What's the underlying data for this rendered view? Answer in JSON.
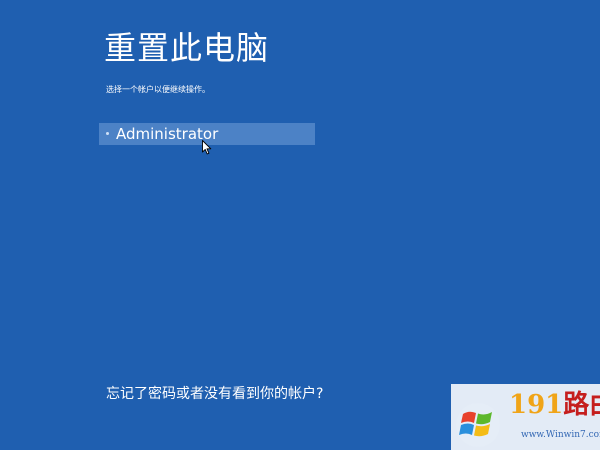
{
  "header": {
    "title": "重置此电脑",
    "subtitle": "选择一个帐户以便继续操作。"
  },
  "accounts": [
    {
      "name": "Administrator"
    }
  ],
  "footer": {
    "forgot_link": "忘记了密码或者没有看到你的帐户?"
  },
  "watermark": {
    "brand_number": "191",
    "brand_text": "路由网",
    "url": "www.Winwin7.com"
  },
  "colors": {
    "background": "#1f5fb0",
    "selected_item": "#4c82c6",
    "text": "#ffffff"
  },
  "icons": {
    "cursor": "mouse-pointer-icon",
    "watermark_logo": "windows-logo-icon"
  }
}
